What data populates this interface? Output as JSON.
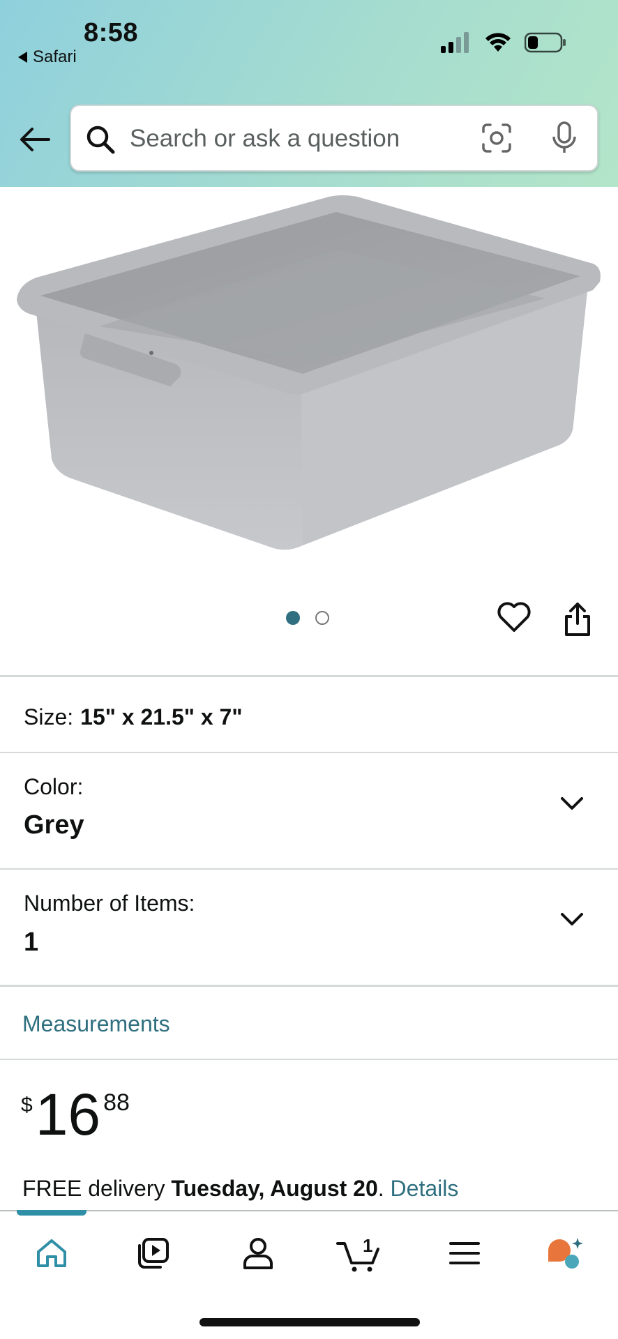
{
  "status_bar": {
    "time": "8:58",
    "back_app": "Safari",
    "icons": [
      "cellular-signal-icon",
      "wifi-icon",
      "battery-icon"
    ]
  },
  "search": {
    "placeholder": "Search or ask a question",
    "icons": [
      "back-arrow-icon",
      "search-icon",
      "camera-scan-icon",
      "microphone-icon"
    ]
  },
  "gallery": {
    "image_count": 2,
    "active_index": 0,
    "image_alt": "Grey plastic bus tub",
    "actions": [
      "heart-icon",
      "share-icon"
    ]
  },
  "size": {
    "label": "Size:",
    "value": "15\" x 21.5\" x 7\""
  },
  "color": {
    "label": "Color:",
    "value": "Grey"
  },
  "items": {
    "label": "Number of Items:",
    "value": "1"
  },
  "measurements": {
    "label": "Measurements"
  },
  "price": {
    "currency": "$",
    "whole": "16",
    "fraction": "88"
  },
  "delivery": {
    "prefix": "FREE delivery",
    "date": "Tuesday, August 20",
    "suffix": ".",
    "link": "Details"
  },
  "bottom_nav": {
    "items": [
      "home-icon",
      "video-icon",
      "account-icon",
      "cart-icon",
      "menu-icon",
      "rufus-assistant-icon"
    ],
    "cart_count": "1",
    "active": "home"
  },
  "colors": {
    "accent": "#2f6f7f",
    "header_gradient_start": "#8fd0dd",
    "header_gradient_end": "#b3e5c9",
    "assistant_orange": "#e8763c",
    "assistant_teal": "#4aa6b8"
  }
}
